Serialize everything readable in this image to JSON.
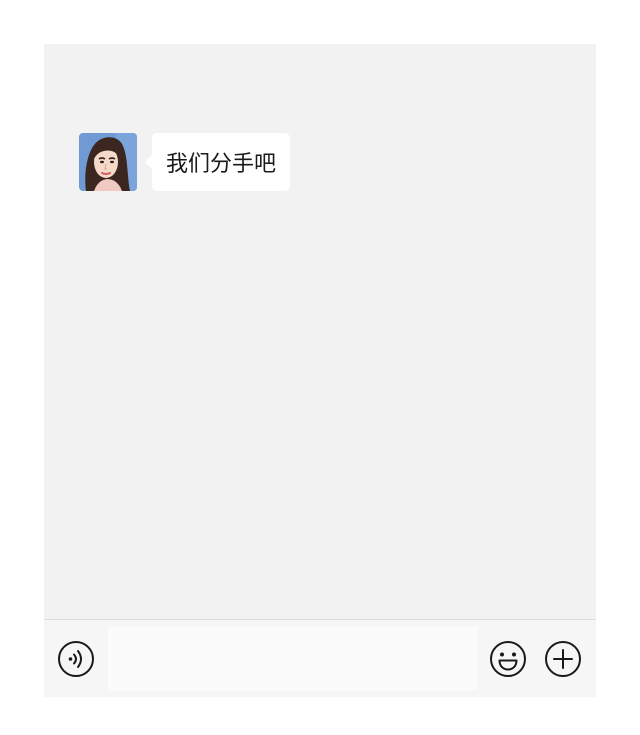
{
  "chat": {
    "messages": [
      {
        "sender": "contact",
        "text": "我们分手吧",
        "avatar": "woman-portrait-avatar"
      }
    ]
  },
  "input_bar": {
    "voice_icon": "voice-icon",
    "text_value": "",
    "emoji_icon": "smiley-emoji-icon",
    "plus_icon": "plus-circle-icon"
  },
  "colors": {
    "chat_background": "#f2f2f2",
    "bubble_background": "#ffffff",
    "input_bar_background": "#f6f6f6",
    "icon_stroke": "#1a1a1a"
  }
}
